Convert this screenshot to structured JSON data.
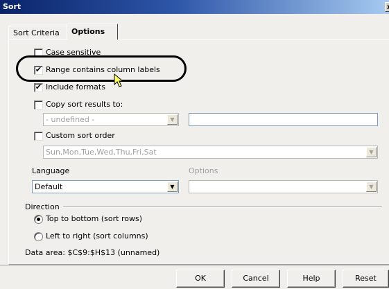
{
  "window": {
    "title": "Sort",
    "close_glyph": "x"
  },
  "tabs": [
    {
      "label": "Sort Criteria",
      "active": false
    },
    {
      "label": "Options",
      "active": true
    }
  ],
  "options": {
    "case_sensitive": {
      "label": "Case sensitive",
      "checked": false
    },
    "range_labels": {
      "label": "Range contains column labels",
      "checked": true
    },
    "include_formats": {
      "label": "Include formats",
      "checked": true
    },
    "copy_results": {
      "label": "Copy sort results to:",
      "checked": false
    },
    "copy_target_value": "- undefined -",
    "copy_target_text": "",
    "custom_order": {
      "label": "Custom sort order",
      "checked": false
    },
    "custom_order_value": "Sun,Mon,Tue,Wed,Thu,Fri,Sat",
    "language_label": "Language",
    "language_value": "Default",
    "options_label": "Options",
    "options_value": ""
  },
  "direction": {
    "label": "Direction",
    "top_to_bottom": {
      "label": "Top to bottom (sort rows)",
      "selected": true
    },
    "left_to_right": {
      "label": "Left to right (sort columns)",
      "selected": false
    }
  },
  "data_area": "Data area: $C$9:$H$13 (unnamed)",
  "buttons": {
    "ok": "OK",
    "cancel": "Cancel",
    "help": "Help",
    "reset": "Reset"
  },
  "icons": {
    "check": "check-icon",
    "dropdown": "chevron-down-icon",
    "cursor": "mouse-pointer-icon"
  }
}
